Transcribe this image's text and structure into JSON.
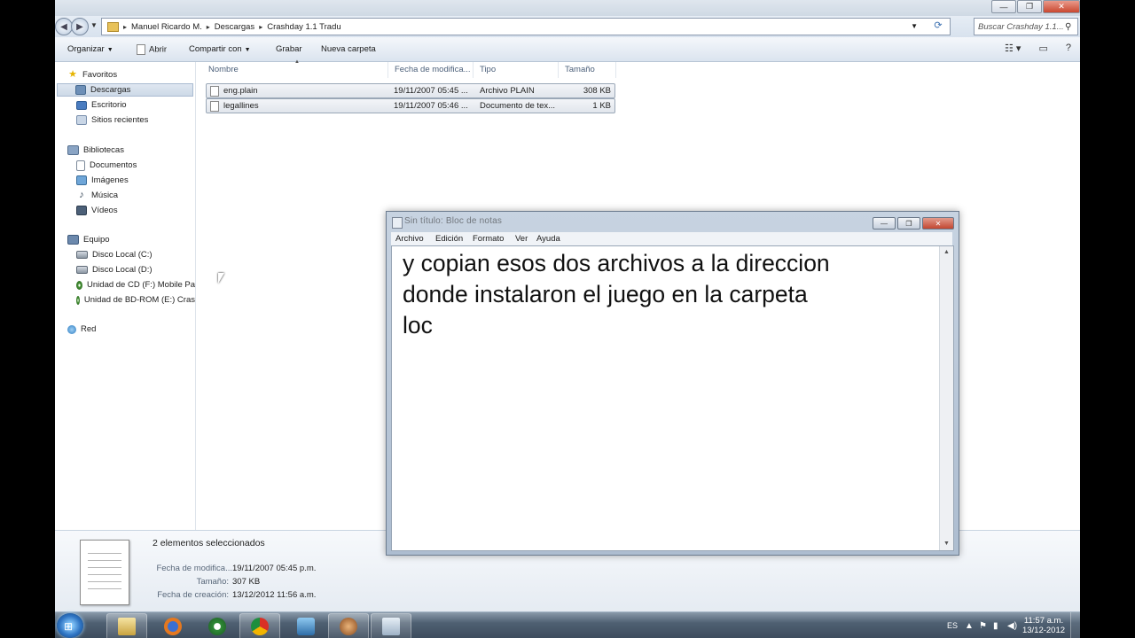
{
  "explorer": {
    "breadcrumb": [
      "Manuel Ricardo M.",
      "Descargas",
      "Crashday 1.1 Tradu"
    ],
    "search_placeholder": "Buscar Crashday 1.1...",
    "commands": {
      "organizar": "Organizar",
      "abrir": "Abrir",
      "compartir": "Compartir con",
      "grabar": "Grabar",
      "nueva_carpeta": "Nueva carpeta"
    },
    "nav": {
      "favoritos": "Favoritos",
      "descargas": "Descargas",
      "escritorio": "Escritorio",
      "sitios": "Sitios recientes",
      "bibliotecas": "Bibliotecas",
      "documentos": "Documentos",
      "imagenes": "Imágenes",
      "musica": "Música",
      "videos": "Vídeos",
      "equipo": "Equipo",
      "disco_c": "Disco Local (C:)",
      "disco_d": "Disco Local (D:)",
      "cd_f": "Unidad de CD (F:) Mobile Pa",
      "bd_e": "Unidad de BD-ROM (E:) Cras",
      "red": "Red"
    },
    "columns": {
      "nombre": "Nombre",
      "fecha": "Fecha de modifica...",
      "tipo": "Tipo",
      "tamano": "Tamaño"
    },
    "files": [
      {
        "name": "eng.plain",
        "date": "19/11/2007 05:45 ...",
        "type": "Archivo PLAIN",
        "size": "308 KB"
      },
      {
        "name": "legallines",
        "date": "19/11/2007 05:46 ...",
        "type": "Documento de tex...",
        "size": "1 KB"
      }
    ],
    "details": {
      "selected": "2 elementos seleccionados",
      "mod_label": "Fecha de modifica...",
      "mod_value": "19/11/2007 05:45 p.m.",
      "size_label": "Tamaño:",
      "size_value": "307 KB",
      "created_label": "Fecha de creación:",
      "created_value": "13/12/2012 11:56 a.m."
    }
  },
  "notepad": {
    "title": "Sin título: Bloc de notas",
    "menu": {
      "archivo": "Archivo",
      "edicion": "Edición",
      "formato": "Formato",
      "ver": "Ver",
      "ayuda": "Ayuda"
    },
    "text_line1": "y copian esos dos archivos a la direccion",
    "text_line2": "donde instalaron el juego en la carpeta",
    "text_line3": "loc"
  },
  "taskbar": {
    "language": "ES",
    "time": "11:57 a.m.",
    "date": "13/12-2012"
  },
  "colors": {
    "accent": "#3c4b5c",
    "selection": "#cdd9e7",
    "notepad_frame": "#adbdd0"
  }
}
